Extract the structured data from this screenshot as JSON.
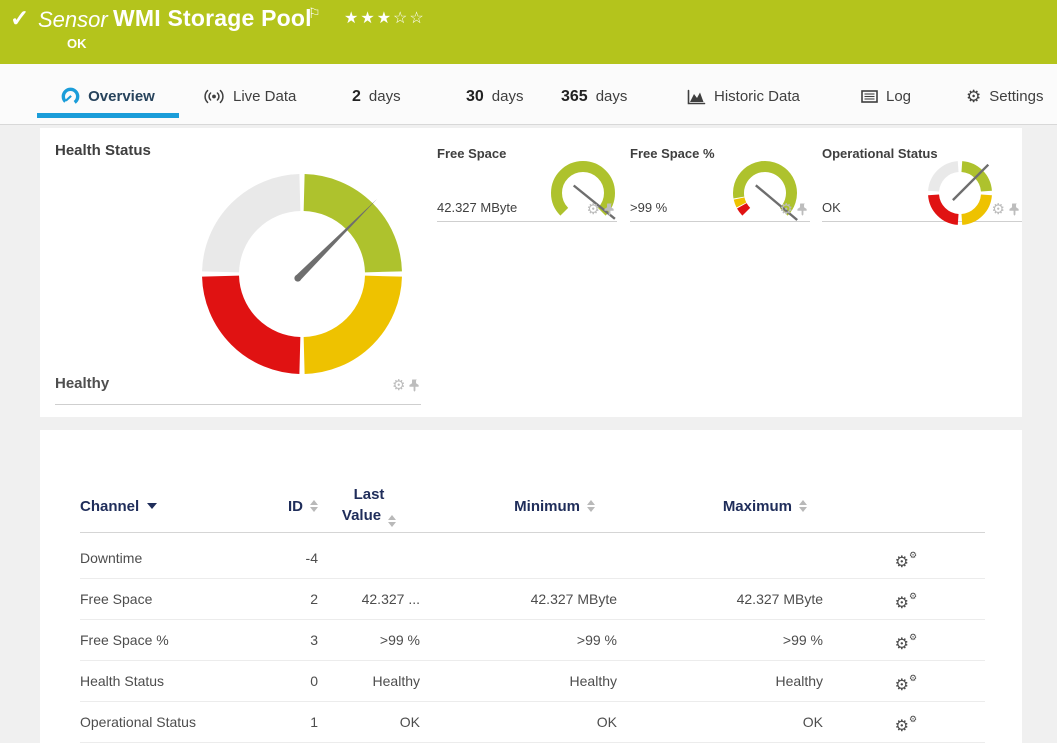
{
  "colors": {
    "brand-green": "#b4c41c",
    "accent-blue": "#1b9dd9",
    "gauge-green": "#aec22d",
    "gauge-yellow": "#eec200",
    "gauge-red": "#e01212",
    "gauge-gray": "#e9e9e9",
    "needle-gray": "#6e6e6e",
    "header-navy": "#1f2d5a",
    "icon-light": "#bdbdbd"
  },
  "icons": {
    "check": "✓",
    "flag": "⚐",
    "gear": "⚙",
    "gear_small": "⚙"
  },
  "header": {
    "type_label": "Sensor",
    "title": "WMI Storage Pool",
    "status": "OK",
    "stars": "★★★☆☆"
  },
  "tabs": {
    "overview": {
      "label": "Overview"
    },
    "live": {
      "label": "Live Data"
    },
    "d2": {
      "num": "2",
      "unit": "days"
    },
    "d30": {
      "num": "30",
      "unit": "days"
    },
    "d365": {
      "num": "365",
      "unit": "days"
    },
    "historic": {
      "label": "Historic Data"
    },
    "log": {
      "label": "Log"
    },
    "settings": {
      "label": "Settings"
    }
  },
  "gauges": {
    "main": {
      "title": "Health Status",
      "value": "Healthy"
    },
    "free_space": {
      "title": "Free Space",
      "value": "42.327 MByte"
    },
    "free_space_pct": {
      "title": "Free Space %",
      "value": ">99 %"
    },
    "operational": {
      "title": "Operational Status",
      "value": "OK"
    }
  },
  "table": {
    "headers": {
      "channel": "Channel",
      "id": "ID",
      "last": "Last Value",
      "min": "Minimum",
      "max": "Maximum"
    },
    "rows": [
      {
        "channel": "Downtime",
        "id": "-4",
        "last": "",
        "min": "",
        "max": ""
      },
      {
        "channel": "Free Space",
        "id": "2",
        "last": "42.327 ...",
        "min": "42.327 MByte",
        "max": "42.327 MByte"
      },
      {
        "channel": "Free Space %",
        "id": "3",
        "last": ">99 %",
        "min": ">99 %",
        "max": ">99 %"
      },
      {
        "channel": "Health Status",
        "id": "0",
        "last": "Healthy",
        "min": "Healthy",
        "max": "Healthy"
      },
      {
        "channel": "Operational Status",
        "id": "1",
        "last": "OK",
        "min": "OK",
        "max": "OK"
      }
    ]
  }
}
